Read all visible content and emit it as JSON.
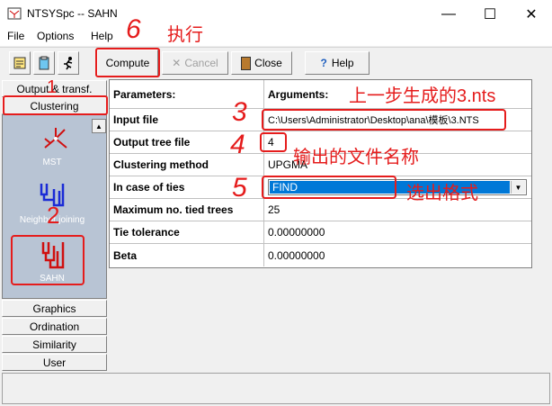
{
  "window": {
    "title": "NTSYSpc  -- SAHN",
    "minimize": "—",
    "maximize": "☐",
    "close": "✕"
  },
  "menu": {
    "file": "File",
    "options": "Options",
    "help": "Help"
  },
  "toolbar": {
    "compute": "Compute",
    "cancel": "Cancel",
    "close": "Close",
    "help": "Help"
  },
  "sidebar": {
    "top_buttons": [
      "Output & transf.",
      "Clustering"
    ],
    "tools": [
      "MST",
      "Neighbor joining",
      "SAHN"
    ],
    "bottom_buttons": [
      "Graphics",
      "Ordination",
      "Similarity",
      "User"
    ]
  },
  "grid": {
    "header_param": "Parameters:",
    "header_arg": "Arguments:",
    "rows": [
      {
        "param": "Input file",
        "value": "C:\\Users\\Administrator\\Desktop\\ana\\模板\\3.NTS"
      },
      {
        "param": "Output tree file",
        "value": "4"
      },
      {
        "param": "Clustering method",
        "value": "UPGMA"
      },
      {
        "param": "In case of ties",
        "value": "FIND"
      },
      {
        "param": "Maximum no. tied trees",
        "value": "25"
      },
      {
        "param": "Tie tolerance",
        "value": "0.00000000"
      },
      {
        "param": "Beta",
        "value": "0.00000000"
      }
    ]
  },
  "annotations": {
    "n1": "1",
    "n2": "2",
    "n3": "3",
    "n4": "4",
    "n5": "5",
    "n6": "6",
    "execute": "执行",
    "input_note": "上一步生成的3.nts",
    "output_note": "输出的文件名称",
    "format_note": "选出格式"
  },
  "colors": {
    "annotation": "#e51c1c",
    "selection": "#0078d7",
    "panel": "#b8c4d4"
  }
}
